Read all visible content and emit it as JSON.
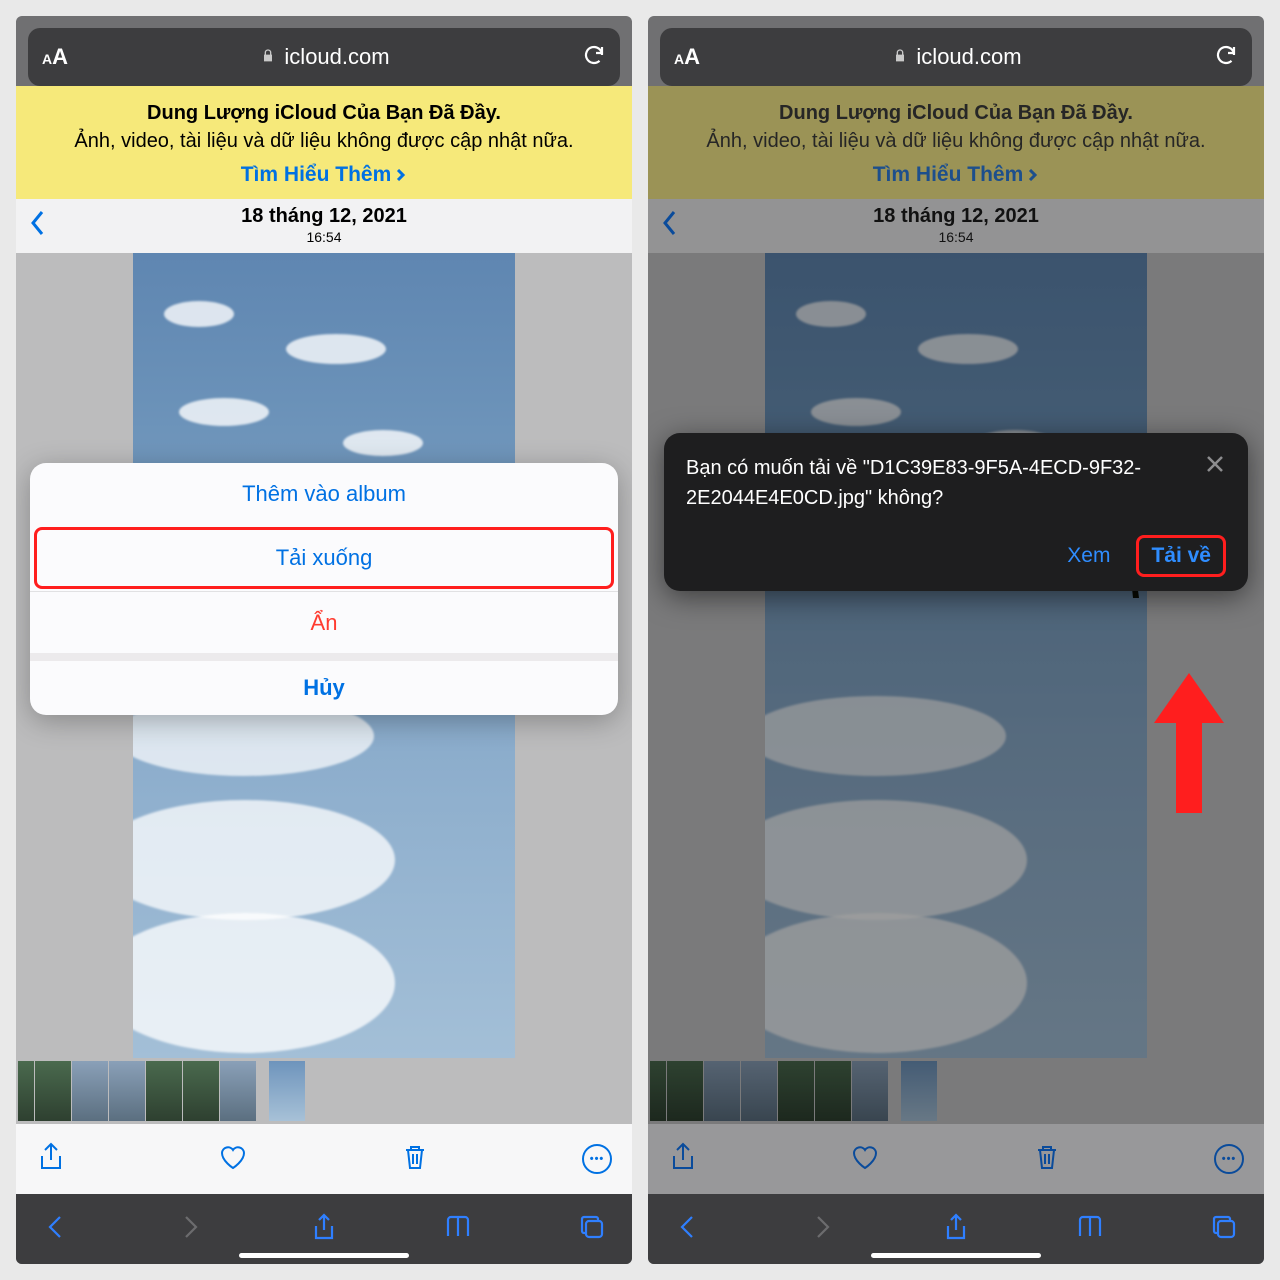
{
  "addressbar": {
    "domain": "icloud.com"
  },
  "banner": {
    "title": "Dung Lượng iCloud Của Bạn Đã Đầy.",
    "subtitle": "Ảnh, video, tài liệu và dữ liệu không được cập nhật nữa.",
    "link": "Tìm Hiểu Thêm"
  },
  "header": {
    "date": "18 tháng 12, 2021",
    "time": "16:54"
  },
  "sheet": {
    "add": "Thêm vào album",
    "download": "Tải xuống",
    "hide": "Ẩn",
    "cancel": "Hủy"
  },
  "dialog": {
    "message": "Bạn có muốn tải về \"D1C39E83-9F5A-4ECD-9F32-2E2044E4E0CD.jpg\" không?",
    "view": "Xem",
    "download": "Tải về"
  },
  "icons": {
    "aa_small": "A",
    "aa_large": "A",
    "more_dots": "•••"
  }
}
